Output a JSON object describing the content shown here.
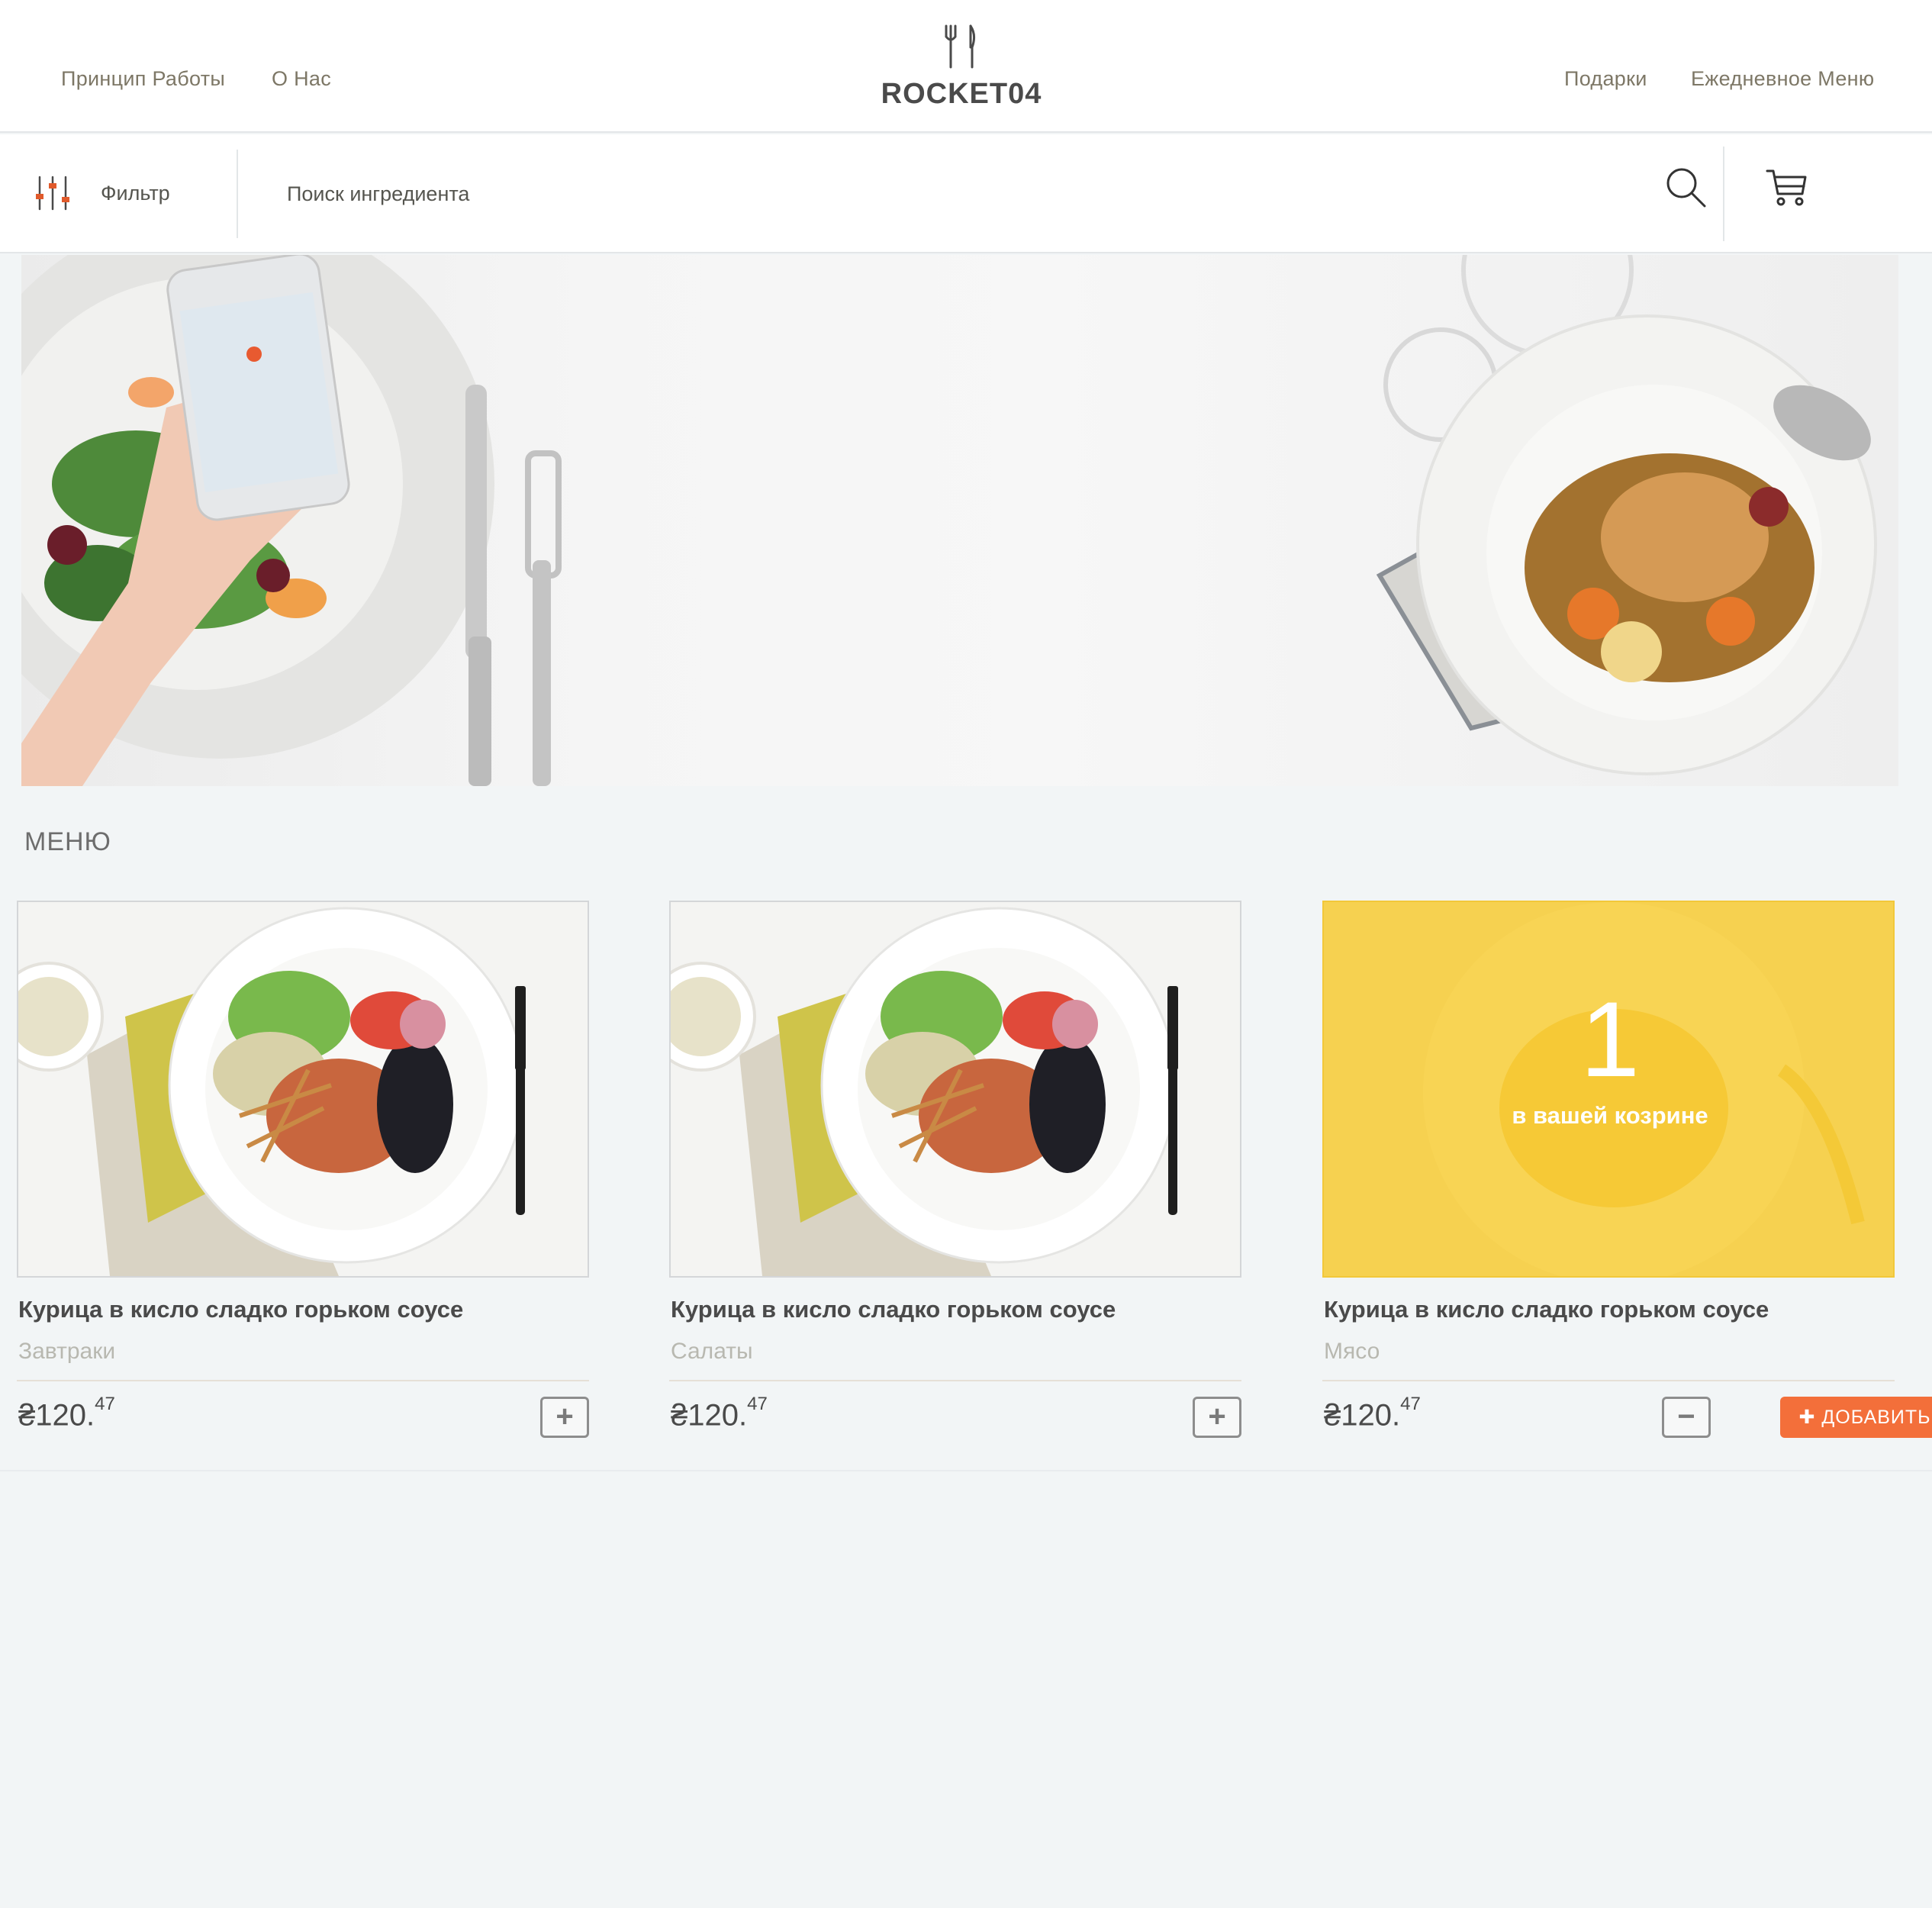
{
  "header": {
    "nav_left": [
      "Принцип Работы",
      "О Нас"
    ],
    "nav_right": [
      "Подарки",
      "Ежедневное Меню"
    ],
    "logo_text": "ROCKET04"
  },
  "toolbar": {
    "filter_label": "Фильтр",
    "search_placeholder": "Поиск ингредиента"
  },
  "menu": {
    "title": "МЕНЮ",
    "cards": [
      {
        "title": "Курица в кисло сладко горьком соусе",
        "category": "Завтраки",
        "price_main": "₴120.",
        "price_cents": "47",
        "plus": "+"
      },
      {
        "title": "Курица в кисло сладко горьком соусе",
        "category": "Салаты",
        "price_main": "₴120.",
        "price_cents": "47",
        "plus": "+"
      },
      {
        "title": "Курица в кисло сладко горьком соусе",
        "category": "Мясо",
        "price_main": "₴120.",
        "price_cents": "47",
        "cart_count": "1",
        "cart_note": "в вашей козрине",
        "minus": "−",
        "add_label": "✚ ДОБАВИТЬ"
      }
    ]
  },
  "colors": {
    "accent": "#f36f3a",
    "overlay": "#f7ca2e",
    "background": "#f2f5f6"
  }
}
